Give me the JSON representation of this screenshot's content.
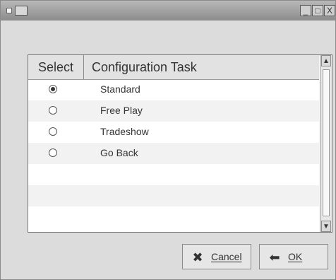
{
  "window": {
    "title_buttons": {
      "minimize": "_",
      "maximize": "□",
      "close": "X"
    }
  },
  "table": {
    "headers": {
      "select": "Select",
      "task": "Configuration Task"
    },
    "rows": [
      {
        "label": "Standard",
        "selected": true
      },
      {
        "label": "Free Play",
        "selected": false
      },
      {
        "label": "Tradeshow",
        "selected": false
      },
      {
        "label": "Go Back",
        "selected": false
      }
    ]
  },
  "buttons": {
    "cancel": {
      "label": "Cancel",
      "icon": "cancel-icon"
    },
    "ok": {
      "label": "OK",
      "icon": "back-arrow-icon"
    }
  },
  "colors": {
    "window_bg": "#dcdcdc",
    "titlebar": "#8c8c8c",
    "table_bg": "#ffffff",
    "row_alt": "#f2f2f2"
  }
}
